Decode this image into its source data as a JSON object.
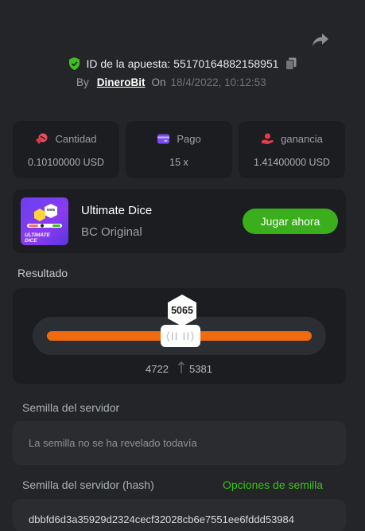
{
  "header": {
    "share_icon": "share-icon",
    "bet_id_label": "ID de la apuesta: 55170164882158951",
    "by_label": "By",
    "username": "DineroBit",
    "on_label": "On",
    "datetime": "18/4/2022, 10:12:53"
  },
  "stats": [
    {
      "label": "Cantidad",
      "value": "0.10100000 USD",
      "icon": "coins-icon",
      "color": "#ee4a5c"
    },
    {
      "label": "Pago",
      "value": "15 x",
      "icon": "card-icon",
      "color": "#7a4cf0"
    },
    {
      "label": "ganancia",
      "value": "1.41400000 USD",
      "icon": "hand-coins-icon",
      "color": "#e53c4b"
    }
  ],
  "game": {
    "name": "Ultimate Dice",
    "provider": "BC Original",
    "play_label": "Jugar ahora",
    "thumb_text": "ULTIMATE DICE",
    "thumb_badge": "5065"
  },
  "result": {
    "label": "Resultado",
    "number": "5065",
    "range_low": "4722",
    "range_high": "5381",
    "handle_glyph": "⟨II II⟩"
  },
  "seeds": {
    "server_seed_label": "Semilla del servidor",
    "server_seed_value": "La semilla no se ha revelado todavía",
    "server_hash_label": "Semilla del servidor (hash)",
    "seed_options_label": "Opciones de semilla",
    "server_hash_value": "dbbfd6d3a35929d2324cecf32028cb6e7551ee6fddd53984"
  },
  "colors": {
    "background": "#232528",
    "card": "#1b1d20",
    "accent_green": "#3aae1b",
    "bar_orange": "#f06a0f"
  }
}
